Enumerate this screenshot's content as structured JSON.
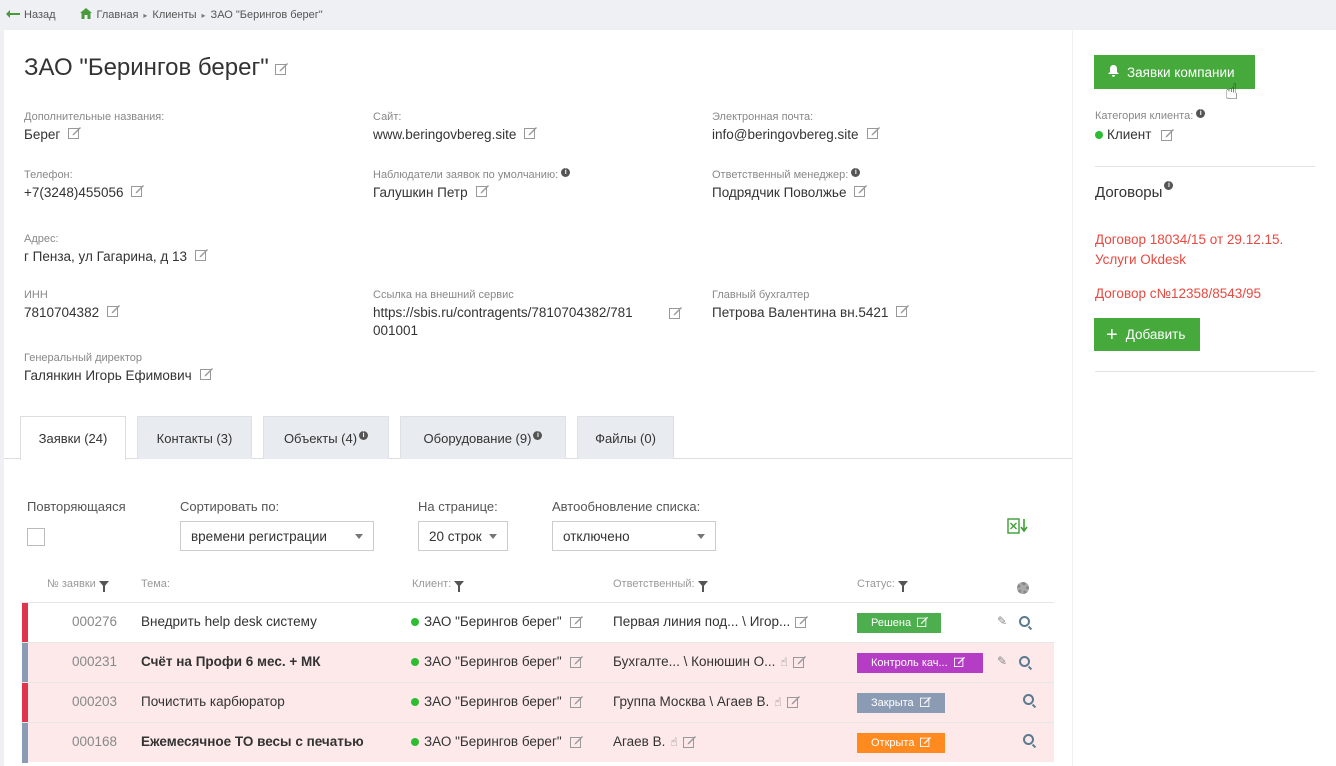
{
  "nav": {
    "back": "Назад",
    "breadcrumbs": [
      "Главная",
      "Клиенты",
      "ЗАО \"Берингов берег\""
    ]
  },
  "company": {
    "title": "ЗАО \"Берингов берег\""
  },
  "fields": {
    "alt_names": {
      "label": "Дополнительные названия:",
      "value": "Берег"
    },
    "site": {
      "label": "Сайт:",
      "value": "www.beringovbereg.site"
    },
    "email": {
      "label": "Электронная почта:",
      "value": "info@beringovbereg.site"
    },
    "phone": {
      "label": "Телефон:",
      "value": "+7(3248)455056"
    },
    "observers": {
      "label": "Наблюдатели заявок по умолчанию:",
      "value": "Галушкин Петр"
    },
    "manager": {
      "label": "Ответственный менеджер:",
      "value": "Подрядчик Поволжье"
    },
    "address": {
      "label": "Адрес:",
      "value": "г Пенза, ул Гагарина, д 13"
    },
    "inn": {
      "label": "ИНН",
      "value": "7810704382"
    },
    "external_link": {
      "label": "Ссылка на внешний сервис",
      "value_line1": "https://sbis.ru/contragents/7810704382/781",
      "value_line2": "001001"
    },
    "accountant": {
      "label": "Главный бухгалтер",
      "value": "Петрова Валентина вн.5421"
    },
    "director": {
      "label": "Генеральный директор",
      "value": "Галянкин Игорь Ефимович"
    }
  },
  "tabs": [
    {
      "label": "Заявки (24)",
      "active": true
    },
    {
      "label": "Контакты (3)"
    },
    {
      "label": "Объекты (4)"
    },
    {
      "label": "Оборудование (9)"
    },
    {
      "label": "Файлы (0)"
    }
  ],
  "filters": {
    "recurring_label": "Повторяющаяся",
    "sort_label": "Сортировать по:",
    "sort_value": "времени регистрации",
    "per_page_label": "На странице:",
    "per_page_value": "20 строк",
    "autorefresh_label": "Автообновление списка:",
    "autorefresh_value": "отключено"
  },
  "table": {
    "headers": {
      "num": "№ заявки",
      "topic": "Тема:",
      "client": "Клиент:",
      "responsible": "Ответственный:",
      "status": "Статус:"
    },
    "rows": [
      {
        "num": "000276",
        "topic": "Внедрить help desk систему",
        "client": "ЗАО \"Берингов берег\"",
        "responsible": "Первая линия под... \\ Игор...",
        "status": "Решена",
        "status_color": "#4cae4c",
        "stripe": "#e0334e",
        "bg": "#ffffff",
        "bold": false,
        "clip": true,
        "hand": false
      },
      {
        "num": "000231",
        "topic": "Счёт на Профи 6 мес. + МК",
        "client": "ЗАО \"Берингов берег\"",
        "responsible": "Бухгалте... \\ Конюшин О...",
        "status": "Контроль кач...",
        "status_color": "#b53cc4",
        "stripe": "#8a9bb5",
        "bg": "#fde9ea",
        "bold": true,
        "clip": true,
        "hand": true
      },
      {
        "num": "000203",
        "topic": "Почистить карбюратор",
        "client": "ЗАО \"Берингов берег\"",
        "responsible": "Группа Москва \\ Агаев В.",
        "status": "Закрыта",
        "status_color": "#8c9bb4",
        "stripe": "#e0334e",
        "bg": "#fde9ea",
        "bold": false,
        "clip": false,
        "hand": true
      },
      {
        "num": "000168",
        "topic": "Ежемесячное ТО весы с печатью",
        "client": "ЗАО \"Берингов берег\"",
        "responsible": "Агаев В.",
        "status": "Открыта",
        "status_color": "#ff8a1f",
        "stripe": "#8a9bb5",
        "bg": "#fde9ea",
        "bold": true,
        "clip": false,
        "hand": true
      }
    ]
  },
  "side": {
    "requests_button": "Заявки компании",
    "category_label": "Категория клиента:",
    "category_value": "Клиент",
    "contracts_title": "Договоры",
    "contracts": [
      "Договор 18034/15 от 29.12.15. Услуги Okdesk",
      "Договор с№12358/8543/95"
    ],
    "add_button": "Добавить"
  },
  "colors": {
    "accent": "#45a93b",
    "link": "#e8493f"
  }
}
